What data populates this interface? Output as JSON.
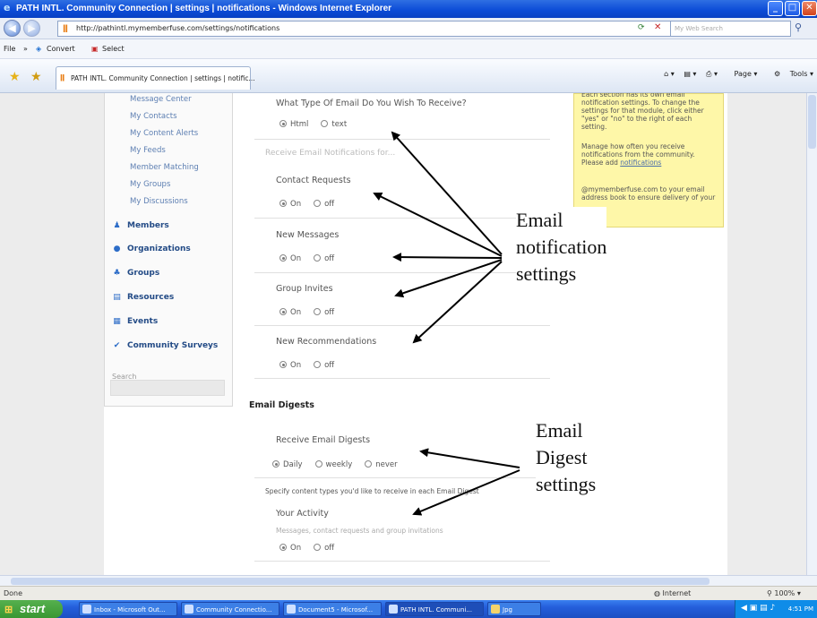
{
  "window": {
    "title": "PATH INTL. Community Connection | settings | notifications - Windows Internet Explorer",
    "ie_icon": "ie-logo-icon",
    "address": "http://pathintl.mymemberfuse.com/settings/notifications",
    "search_placeholder": "My Web Search",
    "links_file": "File",
    "links_convert": "Convert",
    "links_select": "Select",
    "tab_title": "PATH INTL. Community Connection | settings | notific...",
    "cmd_page": "Page",
    "cmd_tools": "Tools"
  },
  "sidebar": {
    "sublinks": [
      "Message Center",
      "My Contacts",
      "My Content Alerts",
      "My Feeds",
      "Member Matching",
      "My Groups",
      "My Discussions"
    ],
    "mainlinks": [
      "Members",
      "Organizations",
      "Groups",
      "Resources",
      "Events",
      "Community Surveys"
    ],
    "search_label": "Search"
  },
  "content": {
    "email_type_q": "What Type Of Email Do You Wish To Receive?",
    "email_type_opts": [
      "Html",
      "text"
    ],
    "receive_head": "Receive Email Notifications for...",
    "contact_requests": "Contact Requests",
    "new_messages": "New Messages",
    "group_invites": "Group Invites",
    "new_recommendations": "New Recommendations",
    "on": "On",
    "off": "off",
    "digests_head": "Email Digests",
    "receive_digests": "Receive Email Digests",
    "digest_opts": [
      "Daily",
      "weekly",
      "never"
    ],
    "specify": "Specify content types you'd like to receive in each Email Digest",
    "your_activity": "Your Activity",
    "activity_note": "Messages, contact requests and group invitations"
  },
  "help_box": {
    "p1": "Each section has its own email notification settings. To change the settings for that module, click either \"yes\" or \"no\" to the right of each setting.",
    "p2": "Manage how often you receive notifications from the community. Please add",
    "link": "notifications",
    "p3": "@mymemberfuse.com to your email address book to ensure delivery of your"
  },
  "callouts": {
    "notif": [
      "Email",
      "notification",
      "settings"
    ],
    "digest": [
      "Email",
      "Digest",
      "settings"
    ]
  },
  "status": {
    "done": "Done",
    "zone": "Internet",
    "zoom": "100%"
  },
  "taskbar": {
    "start": "start",
    "tasks": [
      "Inbox - Microsoft Out...",
      "Community Connectio...",
      "Document5 - Microsof...",
      "PATH INTL. Communi...",
      "Jpg"
    ],
    "clock": "4:51 PM"
  }
}
